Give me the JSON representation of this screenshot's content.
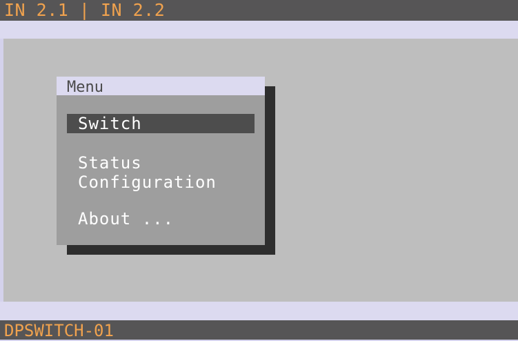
{
  "header": {
    "inputs_text": "IN 2.1 | IN 2.2"
  },
  "menu": {
    "title": "Menu",
    "items": [
      {
        "label": "Switch",
        "selected": true
      },
      {
        "label": "Status",
        "selected": false
      },
      {
        "label": "Configuration",
        "selected": false
      },
      {
        "label": "About ...",
        "selected": false
      }
    ]
  },
  "footer": {
    "device_name": "DPSWITCH-01"
  },
  "colors": {
    "bar_background": "#565556",
    "bar_text": "#f0a24e",
    "strip": "#dcdaf0",
    "workspace": "#bebebe",
    "menu_panel": "#9e9e9e",
    "selection": "#4d4d4d",
    "shadow": "#2e2e2e"
  }
}
